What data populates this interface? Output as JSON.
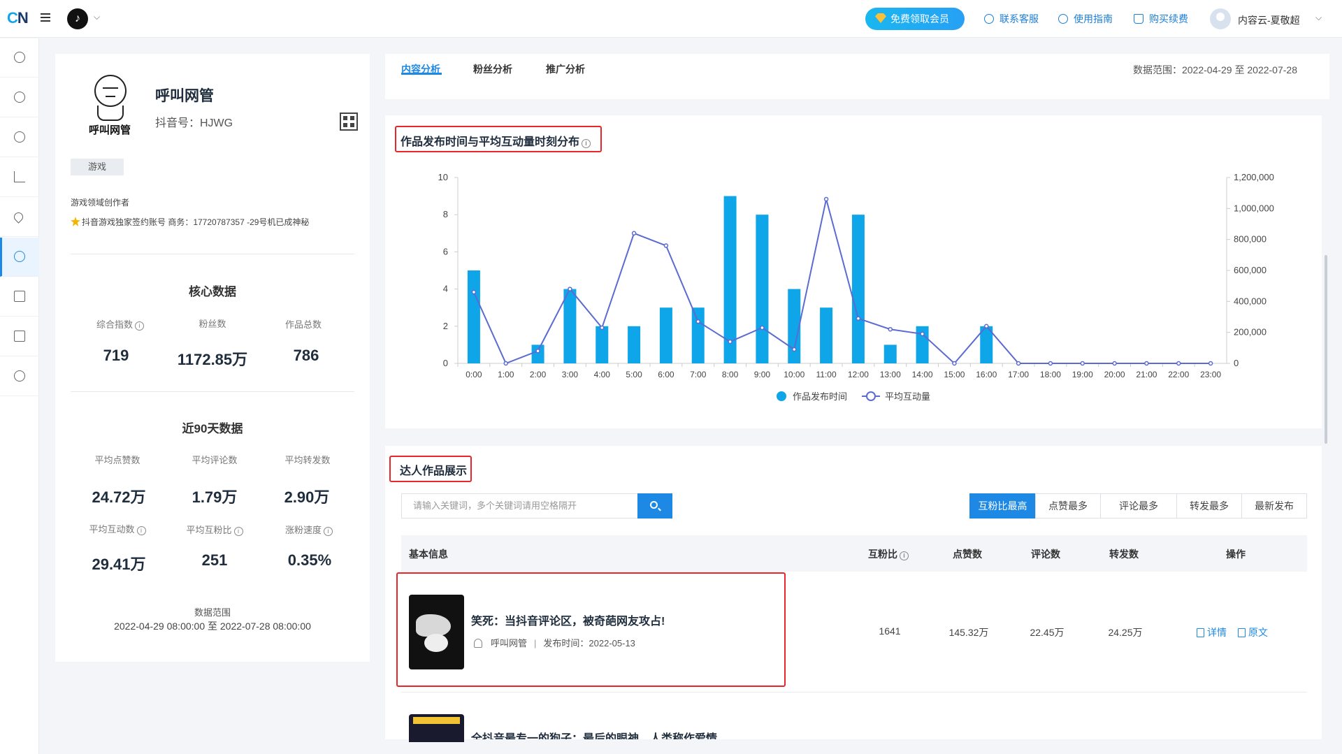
{
  "topbar": {
    "logo_a": "C",
    "logo_b": "N",
    "vip_label": "免费领取会员",
    "links": [
      "联系客服",
      "使用指南",
      "购买续费"
    ],
    "user_name": "内容云-夏敬超"
  },
  "profile": {
    "avatar_caption": "呼叫网管",
    "name": "呼叫网管",
    "douyin_id": "抖音号：HJWG",
    "tag": "游戏",
    "desc1": "游戏领域创作者",
    "desc2": "抖音游戏独家签约账号 商务：17720787357 -29号机已成神秘",
    "core_title": "核心数据",
    "core": [
      {
        "label": "综合指数",
        "value": "719",
        "info": true
      },
      {
        "label": "粉丝数",
        "value": "1172.85万",
        "info": false
      },
      {
        "label": "作品总数",
        "value": "786",
        "info": false
      }
    ],
    "recent_title": "近90天数据",
    "recent_row1": [
      {
        "label": "平均点赞数",
        "value": "24.72万",
        "info": false
      },
      {
        "label": "平均评论数",
        "value": "1.79万",
        "info": false
      },
      {
        "label": "平均转发数",
        "value": "2.90万",
        "info": false
      }
    ],
    "recent_row2": [
      {
        "label": "平均互动数",
        "value": "29.41万",
        "info": true
      },
      {
        "label": "平均互粉比",
        "value": "251",
        "info": true
      },
      {
        "label": "涨粉速度",
        "value": "0.35%",
        "info": true
      }
    ],
    "range_label": "数据范围",
    "range_value": "2022-04-29 08:00:00 至 2022-07-28 08:00:00"
  },
  "tabs": {
    "items": [
      "内容分析",
      "粉丝分析",
      "推广分析"
    ],
    "active": 0,
    "date_range": "数据范围：2022-04-29 至 2022-07-28"
  },
  "chart_section": {
    "title": "作品发布时间与平均互动量时刻分布"
  },
  "chart_data": {
    "type": "bar",
    "categories": [
      "0:00",
      "1:00",
      "2:00",
      "3:00",
      "4:00",
      "5:00",
      "6:00",
      "7:00",
      "8:00",
      "9:00",
      "10:00",
      "11:00",
      "12:00",
      "13:00",
      "14:00",
      "15:00",
      "16:00",
      "17:00",
      "18:00",
      "19:00",
      "20:00",
      "21:00",
      "22:00",
      "23:00"
    ],
    "series": [
      {
        "name": "作品发布时间",
        "type": "bar",
        "axis": "left",
        "color": "#0ea5e9",
        "values": [
          5,
          0,
          1,
          4,
          2,
          2,
          3,
          3,
          9,
          8,
          4,
          3,
          8,
          1,
          2,
          0,
          2,
          0,
          0,
          0,
          0,
          0,
          0,
          0
        ]
      },
      {
        "name": "平均互动量",
        "type": "line",
        "axis": "right",
        "color": "#5b6bd1",
        "values": [
          460000,
          0,
          80000,
          480000,
          230000,
          840000,
          760000,
          270000,
          140000,
          230000,
          90000,
          1060000,
          290000,
          220000,
          190000,
          0,
          240000,
          0,
          0,
          0,
          0,
          0,
          0,
          0
        ]
      }
    ],
    "ylim_left": [
      0,
      10
    ],
    "yticks_left": [
      "0",
      "2",
      "4",
      "6",
      "8",
      "10"
    ],
    "ylim_right": [
      0,
      1200000
    ],
    "yticks_right": [
      "0",
      "200,000",
      "400,000",
      "600,000",
      "800,000",
      "1,000,000",
      "1,200,000"
    ],
    "legend_position": "bottom",
    "grid": false
  },
  "works": {
    "title": "达人作品展示",
    "search_placeholder": "请输入关键词，多个关键词请用空格隔开",
    "sort_buttons": [
      "互粉比最高",
      "点赞最多",
      "评论最多",
      "转发最多",
      "最新发布"
    ],
    "sort_active": 0,
    "columns": [
      "基本信息",
      "互粉比",
      "点赞数",
      "评论数",
      "转发数",
      "操作"
    ],
    "rows": [
      {
        "title": "笑死：当抖音评论区，被奇葩网友攻占!",
        "author": "呼叫网管",
        "publish": "发布时间：2022-05-13",
        "ratio": "1641",
        "likes": "145.32万",
        "comments": "22.45万",
        "shares": "24.25万",
        "actions": [
          "详情",
          "原文"
        ]
      }
    ],
    "next_row_title": "全抖音最专一的狗子：最后的眼神，人类称作爱情"
  }
}
